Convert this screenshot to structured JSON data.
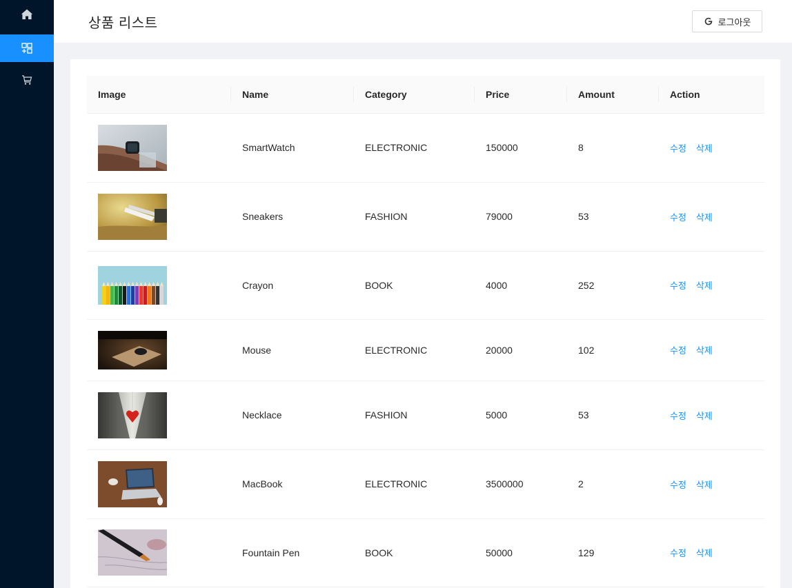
{
  "header": {
    "title": "상품 리스트",
    "logout_label": "로그아웃"
  },
  "sidebar": {
    "items": [
      {
        "icon": "home-icon"
      },
      {
        "icon": "appstore-add-icon",
        "active": true
      },
      {
        "icon": "shopping-cart-icon"
      }
    ]
  },
  "table": {
    "columns": [
      "Image",
      "Name",
      "Category",
      "Price",
      "Amount",
      "Action"
    ],
    "rows": [
      {
        "name": "SmartWatch",
        "category": "ELECTRONIC",
        "price": "150000",
        "amount": "8",
        "edit": "수정",
        "delete": "삭제"
      },
      {
        "name": "Sneakers",
        "category": "FASHION",
        "price": "79000",
        "amount": "53",
        "edit": "수정",
        "delete": "삭제"
      },
      {
        "name": "Crayon",
        "category": "BOOK",
        "price": "4000",
        "amount": "252",
        "edit": "수정",
        "delete": "삭제"
      },
      {
        "name": "Mouse",
        "category": "ELECTRONIC",
        "price": "20000",
        "amount": "102",
        "edit": "수정",
        "delete": "삭제"
      },
      {
        "name": "Necklace",
        "category": "FASHION",
        "price": "5000",
        "amount": "53",
        "edit": "수정",
        "delete": "삭제"
      },
      {
        "name": "MacBook",
        "category": "ELECTRONIC",
        "price": "3500000",
        "amount": "2",
        "edit": "수정",
        "delete": "삭제"
      },
      {
        "name": "Fountain Pen",
        "category": "BOOK",
        "price": "50000",
        "amount": "129",
        "edit": "수정",
        "delete": "삭제"
      }
    ]
  },
  "colors": {
    "sider": "#001529",
    "primary": "#1890ff",
    "page_bg": "#f0f2f5"
  }
}
